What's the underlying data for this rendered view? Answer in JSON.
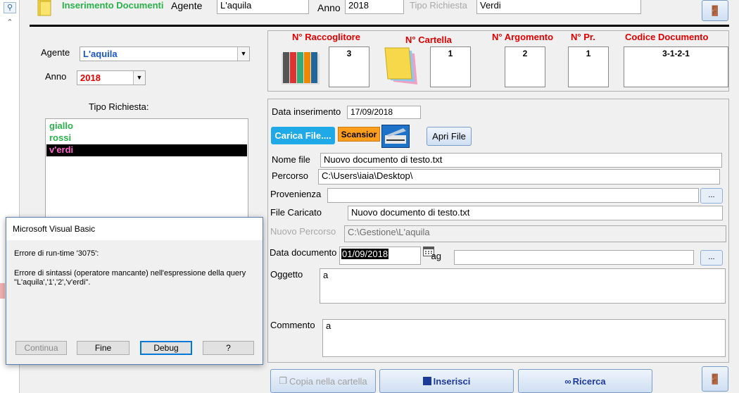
{
  "header": {
    "title": "Inserimento Documenti",
    "agente_label": "Agente",
    "agente_value": "L'aquila",
    "anno_label": "Anno",
    "anno_value": "2018",
    "tipo_label": "Tipo Richiesta",
    "tipo_value": "Verdi"
  },
  "left": {
    "agente_label": "Agente",
    "agente_value": "L'aquila",
    "anno_label": "Anno",
    "anno_value": "2018",
    "tipo_label": "Tipo Richiesta:",
    "tipo_items": [
      "giallo",
      "rossi",
      "v'erdi"
    ]
  },
  "counters": {
    "raccoglitore_label": "N° Raccoglitore",
    "raccoglitore_value": "3",
    "cartella_label": "N° Cartella",
    "cartella_value": "1",
    "argomento_label": "N° Argomento",
    "argomento_value": "2",
    "pr_label": "N° Pr.",
    "pr_value": "1",
    "codice_label": "Codice Documento",
    "codice_value": "3-1-2-1"
  },
  "form": {
    "data_ins_label": "Data inserimento",
    "data_ins_value": "17/09/2018",
    "carica_label": "Carica File....",
    "scansior_label": "Scansior",
    "apri_label": "Apri File",
    "nome_label": "Nome file",
    "nome_value": "Nuovo documento di testo.txt",
    "percorso_label": "Percorso",
    "percorso_value": "C:\\Users\\iaia\\Desktop\\",
    "provenienza_label": "Provenienza",
    "provenienza_value": "",
    "file_caricato_label": "File Caricato",
    "file_caricato_value": "Nuovo documento di testo.txt",
    "nuovo_percorso_label": "Nuovo Percorso",
    "nuovo_percorso_value": "C:\\Gestione\\L'aquila",
    "data_doc_label": "Data documento",
    "data_doc_value": "01/09/2018",
    "tag_label": "Tag",
    "tag_value": "",
    "oggetto_label": "Oggetto",
    "oggetto_value": "a",
    "commento_label": "Commento",
    "commento_value": "a",
    "dots": "..."
  },
  "bottom": {
    "copia_label": "Copia nella cartella",
    "inserisci_label": "Inserisci",
    "ricerca_label": "Ricerca"
  },
  "dialog": {
    "title": "Microsoft Visual Basic",
    "error_line": "Errore di run-time '3075':",
    "message_line1": "Errore di sintassi (operatore mancante) nell'espressione della query",
    "message_line2": "\"L'aquila','1','2','v'erdi\".",
    "continua": "Continua",
    "fine": "Fine",
    "debug": "Debug",
    "help": "?"
  },
  "colors": {
    "title_green": "#2ab24a",
    "label_red": "#e00000",
    "selection_black": "#000000",
    "selection_text": "#ff66cc",
    "carica_blue": "#1fa9e6",
    "scansior_orange": "#ff9d1c"
  }
}
